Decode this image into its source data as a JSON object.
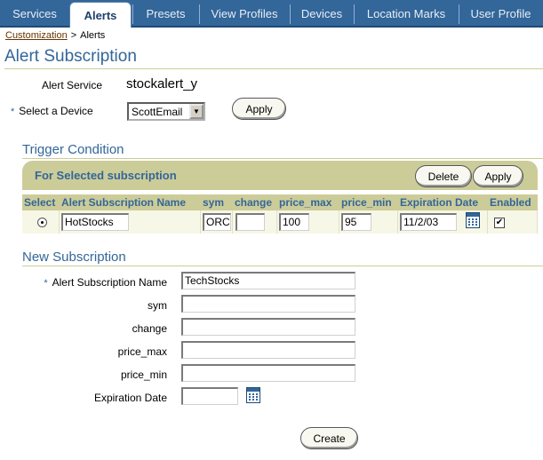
{
  "tabs": [
    {
      "label": "Services",
      "active": false
    },
    {
      "label": "Alerts",
      "active": true
    },
    {
      "label": "Presets",
      "active": false
    },
    {
      "label": "View Profiles",
      "active": false
    },
    {
      "label": "Devices",
      "active": false
    },
    {
      "label": "Location Marks",
      "active": false
    },
    {
      "label": "User Profile",
      "active": false
    }
  ],
  "breadcrumb": {
    "link": "Customization",
    "separator": ">",
    "current": "Alerts"
  },
  "page_title": "Alert Subscription",
  "alert_service": {
    "label": "Alert Service",
    "value": "stockalert_y"
  },
  "device": {
    "required_marker": "*",
    "label": "Select a Device",
    "selected": "ScottEmail",
    "apply_label": "Apply"
  },
  "trigger": {
    "title": "Trigger Condition",
    "box_title": "For Selected subscription",
    "delete_label": "Delete",
    "apply_label": "Apply",
    "columns": [
      "Select",
      "Alert Subscription Name",
      "sym",
      "change",
      "price_max",
      "price_min",
      "Expiration Date",
      "Enabled"
    ],
    "row": {
      "selected": true,
      "name": "HotStocks",
      "sym": "ORCL",
      "change": "",
      "price_max": "100",
      "price_min": "95",
      "expiration": "11/2/03",
      "enabled": true,
      "check_mark": "✔"
    }
  },
  "new_subscription": {
    "title": "New Subscription",
    "required_marker": "*",
    "fields": {
      "name_label": "Alert Subscription Name",
      "name_value": "TechStocks",
      "sym_label": "sym",
      "sym_value": "",
      "change_label": "change",
      "change_value": "",
      "price_max_label": "price_max",
      "price_max_value": "",
      "price_min_label": "price_min",
      "price_min_value": "",
      "expiration_label": "Expiration Date",
      "expiration_value": ""
    },
    "create_label": "Create"
  },
  "colors": {
    "tab_bar": "#336699",
    "accent_text": "#336699",
    "khaki": "#cccc99",
    "breadcrumb_link": "#663300"
  },
  "icons": {
    "calendar": "calendar-icon",
    "dropdown": "chevron-down-icon"
  }
}
